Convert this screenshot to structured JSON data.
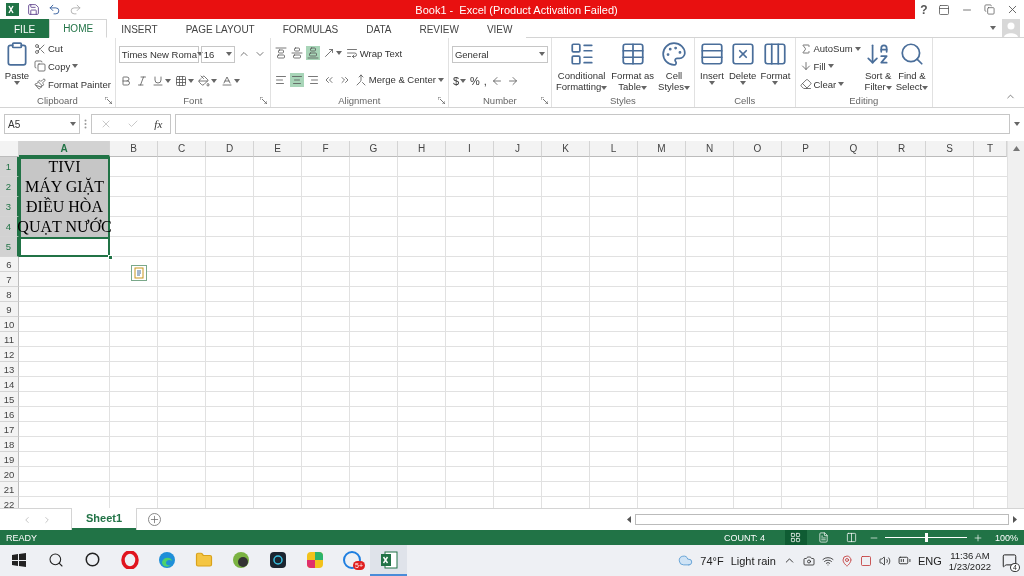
{
  "title_bar": {
    "title": "Book1 -  Excel (Product Activation Failed)",
    "help": "?"
  },
  "ribbon_tabs": [
    {
      "label": "FILE",
      "kind": "file",
      "selected": false
    },
    {
      "label": "HOME",
      "kind": "tab",
      "selected": true
    },
    {
      "label": "INSERT",
      "kind": "tab",
      "selected": false
    },
    {
      "label": "PAGE LAYOUT",
      "kind": "tab",
      "selected": false
    },
    {
      "label": "FORMULAS",
      "kind": "tab",
      "selected": false
    },
    {
      "label": "DATA",
      "kind": "tab",
      "selected": false
    },
    {
      "label": "REVIEW",
      "kind": "tab",
      "selected": false
    },
    {
      "label": "VIEW",
      "kind": "tab",
      "selected": false
    }
  ],
  "ribbon_groups": [
    {
      "label": "Clipboard",
      "launcher": true,
      "blocks": [
        {
          "kind": "large",
          "lines": [
            "Paste"
          ],
          "dropdown": true
        },
        {
          "kind": "stack",
          "rows": [
            [
              {
                "kind": "small",
                "label": "Cut",
                "dropdown": false
              }
            ],
            [
              {
                "kind": "small",
                "label": "Copy",
                "dropdown": true
              }
            ],
            [
              {
                "kind": "small",
                "label": "Format Painter",
                "dropdown": false
              }
            ]
          ]
        }
      ]
    },
    {
      "label": "Font",
      "launcher": true,
      "blocks": [
        {
          "kind": "stack",
          "rows": [
            [
              {
                "kind": "combo",
                "value": "Times New Roma"
              },
              {
                "kind": "spin",
                "value": "16"
              },
              {
                "kind": "icon",
                "selected": false,
                "dropdown": false
              },
              {
                "kind": "icon",
                "selected": false,
                "dropdown": false
              }
            ],
            [
              {
                "kind": "icon",
                "selected": false,
                "dropdown": false
              },
              {
                "kind": "icon",
                "selected": false,
                "dropdown": false
              },
              {
                "kind": "icon",
                "selected": false,
                "dropdown": true
              },
              {
                "kind": "icon",
                "selected": false,
                "dropdown": true
              },
              {
                "kind": "icon",
                "selected": false,
                "dropdown": true
              },
              {
                "kind": "icon",
                "selected": false,
                "dropdown": true
              }
            ]
          ]
        }
      ]
    },
    {
      "label": "Alignment",
      "launcher": true,
      "blocks": [
        {
          "kind": "stack",
          "rows": [
            [
              {
                "kind": "icon",
                "selected": false,
                "dropdown": false
              },
              {
                "kind": "icon",
                "selected": false,
                "dropdown": false
              },
              {
                "kind": "icon",
                "selected": true,
                "dropdown": false
              },
              {
                "kind": "icon",
                "selected": false,
                "dropdown": true
              },
              {
                "kind": "small",
                "label": "Wrap Text",
                "dropdown": false
              }
            ],
            [
              {
                "kind": "icon",
                "selected": false,
                "dropdown": false
              },
              {
                "kind": "icon",
                "selected": true,
                "dropdown": false
              },
              {
                "kind": "icon",
                "selected": false,
                "dropdown": false
              },
              {
                "kind": "icon",
                "selected": false,
                "dropdown": false
              },
              {
                "kind": "icon",
                "selected": false,
                "dropdown": false
              },
              {
                "kind": "small",
                "label": "Merge & Center",
                "dropdown": true
              }
            ]
          ]
        }
      ]
    },
    {
      "label": "Number",
      "launcher": true,
      "blocks": [
        {
          "kind": "stack",
          "rows": [
            [
              {
                "kind": "combo",
                "value": "General"
              }
            ],
            [
              {
                "kind": "letter",
                "label": "$",
                "dropdown": true
              },
              {
                "kind": "letter",
                "label": "%",
                "dropdown": false
              },
              {
                "kind": "letter",
                "label": ",",
                "dropdown": false
              },
              {
                "kind": "icon",
                "selected": false,
                "dropdown": false
              },
              {
                "kind": "icon",
                "selected": false,
                "dropdown": false
              }
            ]
          ]
        }
      ]
    },
    {
      "label": "Styles",
      "launcher": false,
      "blocks": [
        {
          "kind": "large",
          "lines": [
            "Conditional",
            "Formatting"
          ],
          "dropdown": true
        },
        {
          "kind": "large",
          "lines": [
            "Format as",
            "Table"
          ],
          "dropdown": true
        },
        {
          "kind": "large",
          "lines": [
            "Cell",
            "Styles"
          ],
          "dropdown": true
        }
      ]
    },
    {
      "label": "Cells",
      "launcher": false,
      "blocks": [
        {
          "kind": "large",
          "lines": [
            "Insert"
          ],
          "dropdown": true
        },
        {
          "kind": "large",
          "lines": [
            "Delete"
          ],
          "dropdown": true
        },
        {
          "kind": "large",
          "lines": [
            "Format"
          ],
          "dropdown": true
        }
      ]
    },
    {
      "label": "Editing",
      "launcher": false,
      "blocks": [
        {
          "kind": "stack",
          "rows": [
            [
              {
                "kind": "small",
                "label": "AutoSum",
                "dropdown": true
              }
            ],
            [
              {
                "kind": "small",
                "label": "Fill",
                "dropdown": true
              }
            ],
            [
              {
                "kind": "small",
                "label": "Clear",
                "dropdown": true
              }
            ]
          ]
        },
        {
          "kind": "large",
          "lines": [
            "Sort &",
            "Filter"
          ],
          "dropdown": true
        },
        {
          "kind": "large",
          "lines": [
            "Find &",
            "Select"
          ],
          "dropdown": true
        }
      ]
    }
  ],
  "formula_bar": {
    "name_box": "A5",
    "function_label": "fx"
  },
  "columns": [
    {
      "label": "A",
      "selected": true
    },
    {
      "label": "B",
      "selected": false
    },
    {
      "label": "C",
      "selected": false
    },
    {
      "label": "D",
      "selected": false
    },
    {
      "label": "E",
      "selected": false
    },
    {
      "label": "F",
      "selected": false
    },
    {
      "label": "G",
      "selected": false
    },
    {
      "label": "H",
      "selected": false
    },
    {
      "label": "I",
      "selected": false
    },
    {
      "label": "J",
      "selected": false
    },
    {
      "label": "K",
      "selected": false
    },
    {
      "label": "L",
      "selected": false
    },
    {
      "label": "M",
      "selected": false
    },
    {
      "label": "N",
      "selected": false
    },
    {
      "label": "O",
      "selected": false
    },
    {
      "label": "P",
      "selected": false
    },
    {
      "label": "Q",
      "selected": false
    },
    {
      "label": "R",
      "selected": false
    },
    {
      "label": "S",
      "selected": false
    },
    {
      "label": "T",
      "selected": false
    }
  ],
  "rows": [
    {
      "label": "1",
      "selected": true,
      "active": false,
      "value": "TIVI"
    },
    {
      "label": "2",
      "selected": true,
      "active": false,
      "value": "MÁY GIẶT"
    },
    {
      "label": "3",
      "selected": true,
      "active": false,
      "value": "ĐIỀU HÒA"
    },
    {
      "label": "4",
      "selected": true,
      "active": false,
      "value": "QUẠT NƯỚC"
    },
    {
      "label": "5",
      "selected": true,
      "active": true
    },
    {
      "label": "6",
      "selected": false,
      "active": false
    },
    {
      "label": "7",
      "selected": false,
      "active": false
    },
    {
      "label": "8",
      "selected": false,
      "active": false
    },
    {
      "label": "9",
      "selected": false,
      "active": false
    },
    {
      "label": "10",
      "selected": false,
      "active": false
    },
    {
      "label": "11",
      "selected": false,
      "active": false
    },
    {
      "label": "12",
      "selected": false,
      "active": false
    },
    {
      "label": "13",
      "selected": false,
      "active": false
    },
    {
      "label": "14",
      "selected": false,
      "active": false
    },
    {
      "label": "15",
      "selected": false,
      "active": false
    },
    {
      "label": "16",
      "selected": false,
      "active": false
    },
    {
      "label": "17",
      "selected": false,
      "active": false
    },
    {
      "label": "18",
      "selected": false,
      "active": false
    },
    {
      "label": "19",
      "selected": false,
      "active": false
    },
    {
      "label": "20",
      "selected": false,
      "active": false
    },
    {
      "label": "21",
      "selected": false,
      "active": false
    },
    {
      "label": "22",
      "selected": false,
      "active": false
    }
  ],
  "sheet_tabs": [
    {
      "label": "Sheet1",
      "selected": true
    }
  ],
  "status_bar": {
    "status": "READY",
    "count": "COUNT: 4",
    "views": [
      {
        "kind": "normal",
        "selected": true
      },
      {
        "kind": "page-layout",
        "selected": false
      },
      {
        "kind": "page-break",
        "selected": false
      }
    ],
    "zoom": {
      "level": 0.5,
      "reading": "100%"
    }
  },
  "taskbar": {
    "apps": [
      {
        "kind": "start",
        "selected": false
      },
      {
        "kind": "search",
        "selected": false
      },
      {
        "kind": "cortana",
        "selected": false
      },
      {
        "kind": "opera",
        "selected": false
      },
      {
        "kind": "edge",
        "selected": false
      },
      {
        "kind": "folder",
        "selected": false
      },
      {
        "kind": "app-green",
        "selected": false
      },
      {
        "kind": "app-dark",
        "selected": false
      },
      {
        "kind": "app-colorful",
        "selected": false
      },
      {
        "kind": "chat",
        "selected": false,
        "badge": "5+"
      },
      {
        "kind": "excel",
        "selected": true
      }
    ],
    "temperature": "74°F",
    "weather": "Light rain",
    "language": "ENG",
    "time": "11:36 AM",
    "date": "1/23/2022",
    "notifications": "4"
  }
}
